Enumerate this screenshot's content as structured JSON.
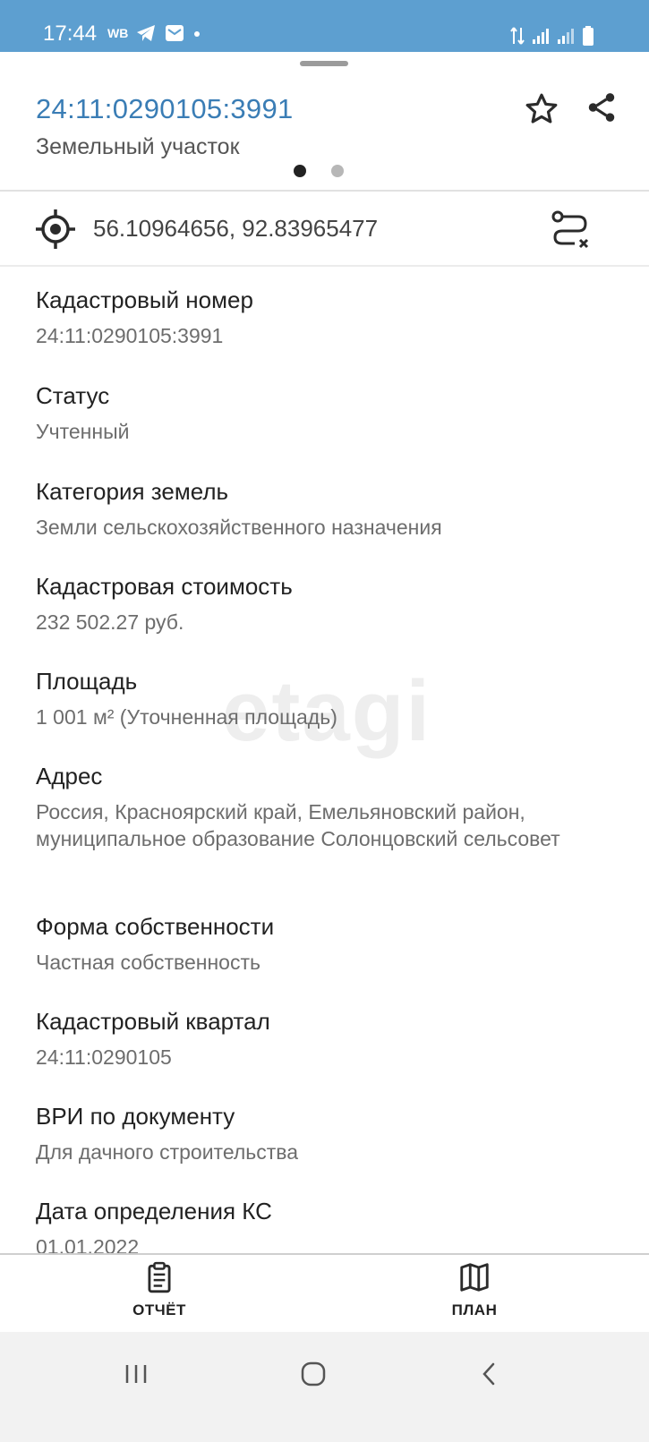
{
  "status_bar": {
    "time": "17:44",
    "left_icons": [
      "wb-icon",
      "telegram-icon",
      "mail-icon",
      "dot-icon"
    ],
    "wb_text": "WB",
    "right_icons": [
      "data-arrows-icon",
      "signal-icon",
      "signal-icon",
      "battery-icon"
    ],
    "background": "#5d9fd0"
  },
  "header": {
    "title": "24:11:0290105:3991",
    "subtitle": "Земельный участок",
    "title_color": "#3a7db5",
    "page_indicator": {
      "pages": 2,
      "active": 1
    }
  },
  "coords": {
    "text": "56.10964656, 92.83965477"
  },
  "fields": [
    {
      "label": "Кадастровый номер",
      "value": "24:11:0290105:3991"
    },
    {
      "label": "Статус",
      "value": "Учтенный"
    },
    {
      "label": "Категория земель",
      "value": "Земли сельскохозяйственного назначения"
    },
    {
      "label": "Кадастровая стоимость",
      "value": "232 502.27 руб."
    },
    {
      "label": "Площадь",
      "value": "1 001 м² (Уточненная площадь)"
    },
    {
      "label": "Адрес",
      "value": "Россия, Красноярский край, Емельяновский район, муниципальное образование Солонцовский сельсовет"
    },
    {
      "label": "Форма собственности",
      "value": "Частная собственность"
    },
    {
      "label": "Кадастровый квартал",
      "value": "24:11:0290105"
    },
    {
      "label": "ВРИ по документу",
      "value": "Для дачного строительства"
    },
    {
      "label": "Дата определения КС",
      "value": "01.01.2022"
    }
  ],
  "watermark": "etagi",
  "bottom_nav": {
    "report_label": "ОТЧЁТ",
    "plan_label": "ПЛАН"
  },
  "system_nav": {
    "icons": [
      "recent-apps-icon",
      "home-icon",
      "back-icon"
    ]
  }
}
